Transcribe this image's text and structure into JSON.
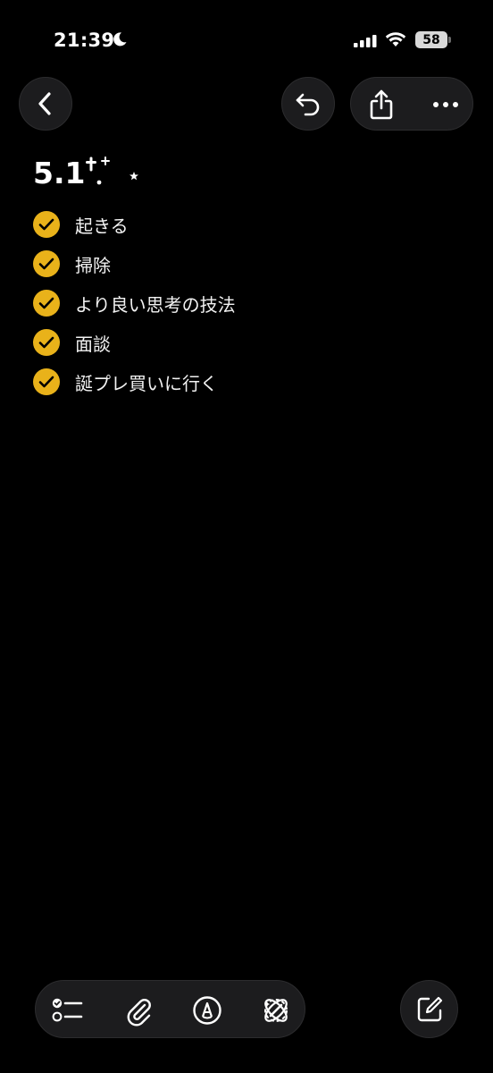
{
  "status_bar": {
    "time": "21:39",
    "focus_icon": "moon-icon",
    "battery": "58"
  },
  "toolbar_top": {
    "back_icon": "chevron-left-icon",
    "undo_icon": "undo-icon",
    "share_icon": "share-icon",
    "more_icon": "ellipsis-icon"
  },
  "note": {
    "title": "5.1",
    "title_decoration": "✝.⁺ ☪",
    "checklist": [
      {
        "label": "起きる",
        "checked": true
      },
      {
        "label": "掃除",
        "checked": true
      },
      {
        "label": "より良い思考の技法",
        "checked": true
      },
      {
        "label": "面談",
        "checked": true
      },
      {
        "label": "誕プレ買いに行く",
        "checked": true
      }
    ]
  },
  "toolbar_bottom": {
    "tools": [
      "checklist-icon",
      "paperclip-icon",
      "markup-pen-icon",
      "writing-tools-icon"
    ],
    "compose_icon": "compose-icon"
  },
  "colors": {
    "background": "#000000",
    "check_fill": "#e9b21a",
    "button_bg": "#1c1c1e"
  }
}
